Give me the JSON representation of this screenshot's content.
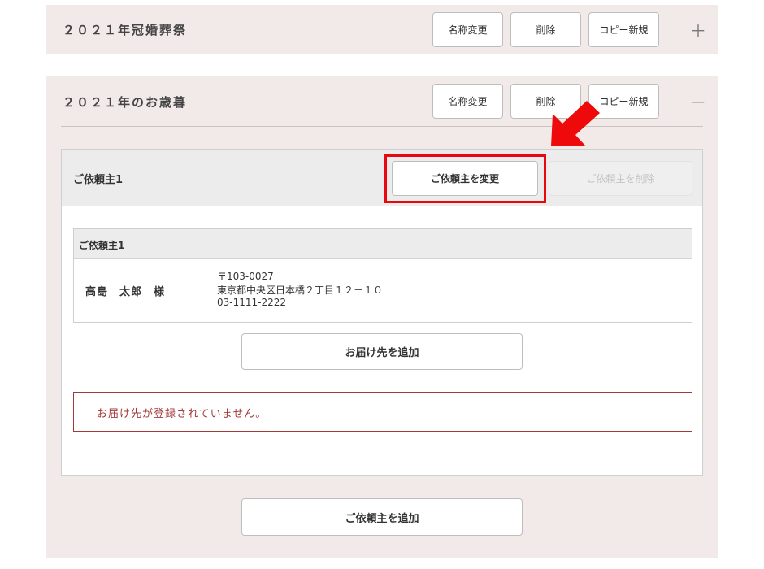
{
  "sections": [
    {
      "title": "２０２１年冠婚葬祭",
      "buttons": {
        "rename": "名称変更",
        "delete": "削除",
        "copy_new": "コピー新規"
      },
      "toggle": "＋"
    },
    {
      "title": "２０２１年のお歳暮",
      "buttons": {
        "rename": "名称変更",
        "delete": "削除",
        "copy_new": "コピー新規"
      },
      "toggle": "－",
      "client": {
        "label": "ご依頼主1",
        "change_button": "ご依頼主を変更",
        "delete_button": "ご依頼主を削除",
        "card_title": "ご依頼主1",
        "name": "高島　太郎　様",
        "postal": "〒103-0027",
        "address": "東京都中央区日本橋２丁目１２－１０",
        "phone": "03-1111-2222",
        "add_destination_button": "お届け先を追加",
        "notice": "お届け先が登録されていません。"
      },
      "add_client_button": "ご依頼主を追加"
    }
  ],
  "colors": {
    "section_bg": "#f2eae9",
    "highlight": "#e8080e",
    "notice": "#a33a3a"
  }
}
